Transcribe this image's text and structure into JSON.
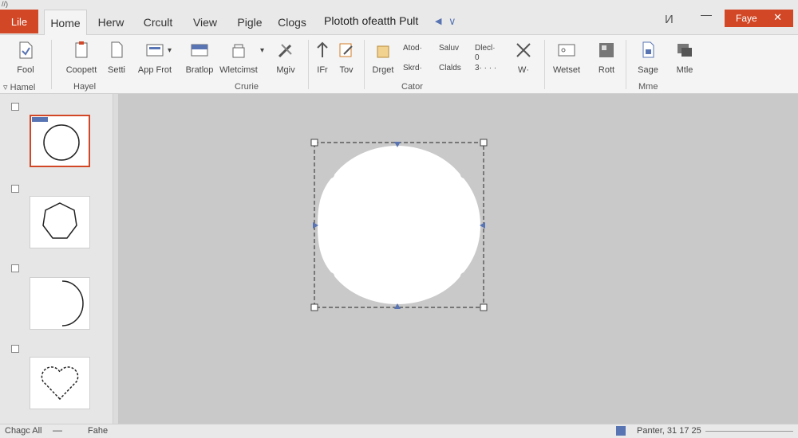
{
  "quick_access": "//)",
  "tabs": {
    "file": "Lile",
    "home": "Home",
    "items": [
      "Herw",
      "Crcult",
      "View",
      "Pigle",
      "Clogs"
    ]
  },
  "doc_title": "Plototh ofeatth Pult",
  "share_button": "Faye",
  "ribbon": {
    "fool": "Fool",
    "coopett": "Coopett",
    "sett": "Setti",
    "app_frot": "App Frot",
    "bratlop": "Bratlop",
    "wletcinst": "Wletcimst",
    "mgiv": "Mgiv",
    "ifr": "IFr",
    "tov": "Tov",
    "drget": "Drget",
    "atodt": "Atod·",
    "saluv": "Saluv",
    "skrd": "Skrd·",
    "clalds": "Clalds",
    "dlecl": "Dlecl·",
    "zero": "0",
    "three": "3· · · ·",
    "w": "W·",
    "wetset": "Wetset",
    "rott": "Rott",
    "sage": "Sage",
    "mtle": "Mtle",
    "groups": {
      "hamel_small": "Hamel",
      "hayel": "Hayel",
      "crurie": "Crurie",
      "cator": "Cator",
      "mme": "Mme"
    }
  },
  "status": {
    "left": "Chagc All",
    "file": "Fahe",
    "right": "Panter, 31 17 25"
  },
  "colors": {
    "accent": "#d24726",
    "handle": "#5874b3"
  }
}
